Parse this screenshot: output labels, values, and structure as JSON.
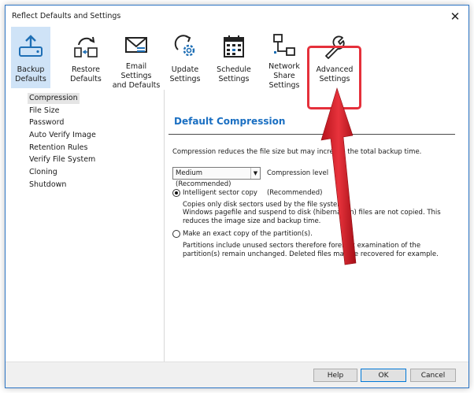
{
  "window": {
    "title": "Reflect Defaults and Settings",
    "close_glyph": "✕"
  },
  "toolbar": {
    "items": [
      {
        "label": "Backup\nDefaults",
        "icon": "backup-defaults-icon"
      },
      {
        "label": "Restore\nDefaults",
        "icon": "restore-defaults-icon"
      },
      {
        "label": "Email Settings\nand Defaults",
        "icon": "email-icon"
      },
      {
        "label": "Update\nSettings",
        "icon": "update-gear-icon"
      },
      {
        "label": "Schedule\nSettings",
        "icon": "calendar-icon"
      },
      {
        "label": "Network Share\nSettings",
        "icon": "network-icon"
      },
      {
        "label": "Advanced\nSettings",
        "icon": "wrench-icon"
      }
    ]
  },
  "nav": {
    "items": [
      "Compression",
      "File Size",
      "Password",
      "Auto Verify Image",
      "Retention Rules",
      "Verify File System",
      "Cloning",
      "Shutdown"
    ]
  },
  "content": {
    "title": "Default Compression",
    "description": "Compression reduces the file size but may increase the total backup time.",
    "compression_select": "Medium (Recommended)",
    "compression_label": "Compression level",
    "option1": {
      "label": "Intelligent sector copy",
      "note": "(Recommended)",
      "line1": "Copies only disk sectors used by the file system.",
      "line2": "Windows pagefile and suspend to disk (hibernation) files are not copied. This reduces the image size and backup time."
    },
    "option2": {
      "label": "Make an exact copy of the partition(s).",
      "line1": "Partitions include unused sectors therefore forensic examination of the partition(s) remain unchanged. Deleted files may be recovered for example."
    }
  },
  "footer": {
    "help": "Help",
    "ok": "OK",
    "cancel": "Cancel"
  },
  "colors": {
    "accent": "#1a6fc2",
    "highlight": "#e5303b",
    "selected_bg": "#cfe3f7"
  }
}
